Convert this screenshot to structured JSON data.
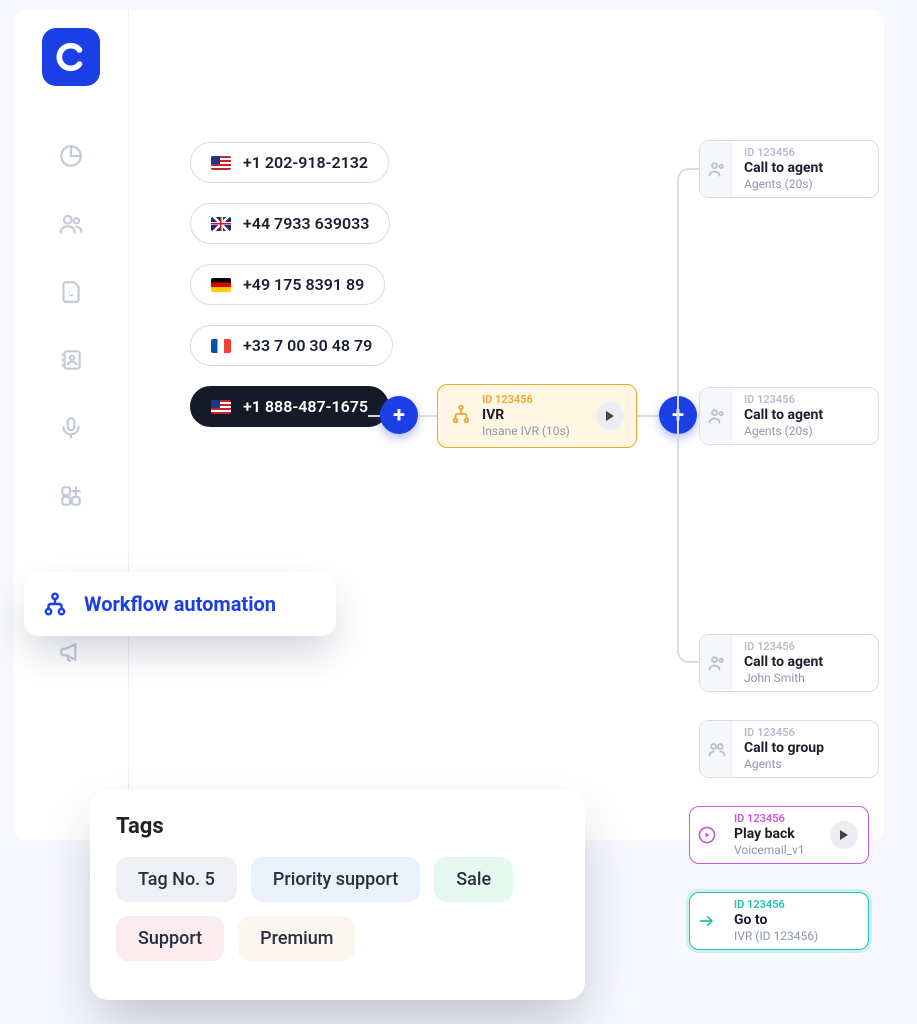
{
  "sidebar": {
    "logo_letter": "C",
    "active_label": "Workflow automation",
    "items": [
      "dashboard",
      "contacts",
      "calls",
      "directory",
      "voice",
      "widgets",
      "workflow",
      "campaigns"
    ]
  },
  "phones": [
    {
      "flag": "us",
      "number": "+1 202-918-2132",
      "selected": false
    },
    {
      "flag": "uk",
      "number": "+44 7933 639033",
      "selected": false
    },
    {
      "flag": "de",
      "number": "+49 175 8391  89",
      "selected": false
    },
    {
      "flag": "fr",
      "number": "+33 7 00 30 48 79",
      "selected": false
    },
    {
      "flag": "us",
      "number": "+1 888-487-1675",
      "selected": true
    }
  ],
  "ivr": {
    "id": "ID 123456",
    "title": "IVR",
    "subtitle": "Insane IVR (10s)"
  },
  "nodes": {
    "top": {
      "id": "ID 123456",
      "title": "Call to agent",
      "sub": "Agents (20s)"
    },
    "mid": {
      "id": "ID 123456",
      "title": "Call to agent",
      "sub": "Agents (20s)"
    },
    "bottom": {
      "id": "ID 123456",
      "title": "Call to agent",
      "sub": "John Smith"
    },
    "group": {
      "id": "ID 123456",
      "title": "Call to group",
      "sub": "Agents"
    },
    "play": {
      "id": "ID 123456",
      "title": "Play back",
      "sub": "Voicemail_v1"
    },
    "goto": {
      "id": "ID 123456",
      "title": "Go to",
      "sub": "IVR (ID 123456)"
    }
  },
  "tags_panel": {
    "title": "Tags",
    "tags": [
      {
        "label": "Tag No. 5",
        "palette": "grey"
      },
      {
        "label": "Priority support",
        "palette": "lav"
      },
      {
        "label": "Sale",
        "palette": "mint"
      },
      {
        "label": "Support",
        "palette": "pink"
      },
      {
        "label": "Premium",
        "palette": "sand"
      }
    ]
  }
}
